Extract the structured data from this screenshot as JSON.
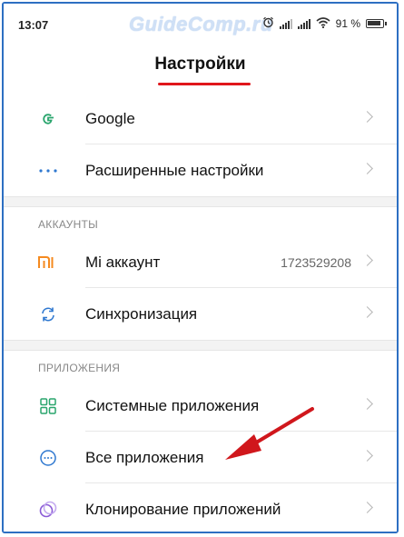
{
  "status_bar": {
    "time": "13:07",
    "battery_text": "91 %",
    "icons": [
      "alarm-icon",
      "signal-icon",
      "signal-icon",
      "wifi-icon",
      "battery-icon"
    ]
  },
  "watermark": "GuideComp.ru",
  "header": {
    "title": "Настройки",
    "underline_color": "#e0161b"
  },
  "groups": [
    {
      "section_title": "",
      "items": [
        {
          "label": "Google",
          "icon": "google-icon",
          "value": ""
        },
        {
          "label": "Расширенные настройки",
          "icon": "more-dots-icon",
          "value": ""
        }
      ]
    },
    {
      "section_title": "АККАУНТЫ",
      "items": [
        {
          "label": "Mi аккаунт",
          "icon": "mi-icon",
          "value": "1723529208"
        },
        {
          "label": "Синхронизация",
          "icon": "sync-icon",
          "value": ""
        }
      ]
    },
    {
      "section_title": "ПРИЛОЖЕНИЯ",
      "items": [
        {
          "label": "Системные приложения",
          "icon": "apps-grid-icon",
          "value": ""
        },
        {
          "label": "Все приложения",
          "icon": "all-apps-icon",
          "value": ""
        },
        {
          "label": "Клонирование приложений",
          "icon": "clone-apps-icon",
          "value": ""
        }
      ]
    }
  ],
  "colors": {
    "frame_border": "#2d6fc2",
    "accent_red": "#e0161b",
    "icon_green": "#2aa56d",
    "icon_blue": "#2f78d0",
    "icon_orange": "#f58a1f",
    "icon_purple": "#8a5ad6"
  }
}
